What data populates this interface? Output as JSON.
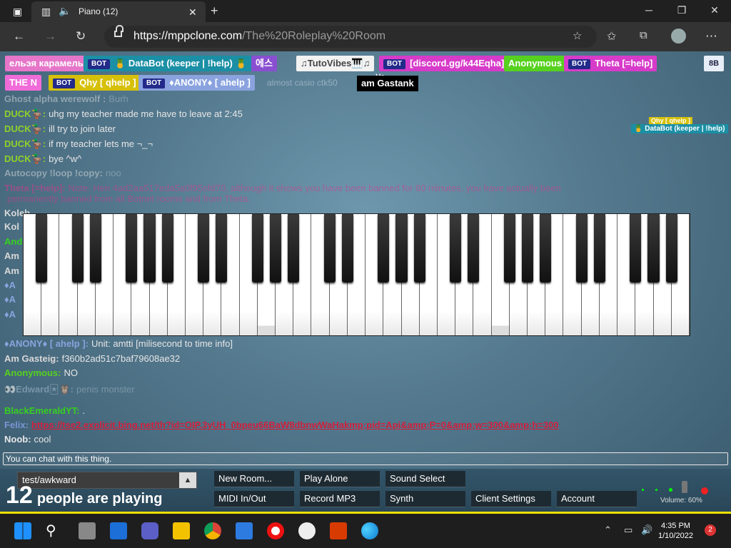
{
  "browser": {
    "tab_title": "Piano (12)",
    "url_domain": "https://mppclone.com",
    "url_path": "/The%20Roleplay%20Room"
  },
  "players": [
    {
      "name": "ельэя карамелья",
      "bg": "#e676c9",
      "bot": false
    },
    {
      "name": "🍍 DataBot (keeper | !help) 🍍",
      "bg": "#1b8fa5",
      "bot": true
    },
    {
      "name": "에스",
      "bg": "#8a4fd1",
      "bot": false
    },
    {
      "name": "♫TutoVibes🎹♫",
      "bg": "#f2f2f2",
      "bot": false
    },
    {
      "name": "[discord.gg/k44Eqha]",
      "bg": "#d73bc9",
      "bot": true
    },
    {
      "name": "Anonymous",
      "bg": "#56d11f",
      "bot": false
    },
    {
      "name": "Theta [=help]",
      "bg": "#d73bc9",
      "bot": true
    },
    {
      "name": "THE N",
      "bg": "#f06cd9",
      "bot": false
    },
    {
      "name": "Qhy [ qhelp ]",
      "bg": "#d6c00a",
      "bot": true
    },
    {
      "name": "♦ANONY♦ [ ahelp ]",
      "bg": "#8aa3df",
      "bot": true
    },
    {
      "name": "almost casio ctk50",
      "bg": "transparent",
      "bot": false
    }
  ],
  "badge_bb": "8B",
  "gastank": {
    "label": "am Gastank",
    "me": "Me"
  },
  "cursor_names": {
    "qhy": "Qhy [ qhelp ]",
    "databot": "🍍 DataBot (keeper | !help)"
  },
  "chat": [
    {
      "name": "Ghost alpha werewolf :",
      "text": "Burh",
      "color": "#c2c9cf"
    },
    {
      "name": "DUCK🦆:",
      "text": "uhg my teacher made me have to leave at 2:45",
      "color": "#8fd12a"
    },
    {
      "name": "DUCK🦆:",
      "text": "ill try to join later",
      "color": "#8fd12a"
    },
    {
      "name": "DUCK🦆:",
      "text": "if my teacher lets me ¬_¬",
      "color": "#8fd12a"
    },
    {
      "name": "DUCK🦆:",
      "text": "bye ^w^",
      "color": "#8fd12a"
    },
    {
      "name": "Autocopy !loop !copy:",
      "text": "noo",
      "color": "#c2c9cf"
    },
    {
      "name": "Theta [=help]:",
      "text": "Note: Hen 4ad2aa517eda5a0f95sfd70, although it shows you have been banned for 60 minutes, you have actually been",
      "color": "#d23c8f"
    },
    {
      "name": "",
      "text": "permanently banned from all Botnet rooms and from Theta.",
      "color": "#d23c8f"
    },
    {
      "name": "♦ANONY♦ [ ahelp ]:",
      "text": "Unit: amtti [milisecond to time info]",
      "color": "#8aa3df"
    },
    {
      "name": "Am Gasteig:",
      "text": "f360b2ad51c7baf79608ae32",
      "color": "#d8d8d8"
    },
    {
      "name": "Anonymous:",
      "text": "NO",
      "color": "#56d11f"
    },
    {
      "name": "👀Edward🃏🦉:",
      "text": "penis monster",
      "color": "#9ab3c6"
    },
    {
      "name": "BlackEmeraldYT:",
      "text": ".",
      "color": "#36d11f"
    },
    {
      "name": "Felix:",
      "text": "https://tse2.explicit.bing.net/th?id=OIP.3yUH_0bpeu66BaW8dbnwWaHakmp;pid=Api&amp;P=0&amp;w=300&amp;h=300",
      "color": "#7a95d6"
    },
    {
      "name": "Noob:",
      "text": "cool",
      "color": "#e8e8e8"
    }
  ],
  "chat_partial_names": [
    "Koleb",
    "Kol",
    "And",
    "Am",
    "Am",
    "♦A",
    "♦A",
    "♦A"
  ],
  "chat_input_placeholder": "You can chat with this thing.",
  "room_select": "test/awkward",
  "player_count": "12",
  "player_count_label": "people are playing",
  "buttons": {
    "new_room": "New Room...",
    "play_alone": "Play Alone",
    "sound_select": "Sound Select",
    "midi": "MIDI In/Out",
    "record": "Record MP3",
    "synth": "Synth",
    "client_settings": "Client Settings",
    "account": "Account"
  },
  "volume_label": "Volume: 60%",
  "taskbar": {
    "time": "4:35 PM",
    "date": "1/10/2022",
    "notifications": "2"
  },
  "piano": {
    "pressed_white_keys": [
      13,
      26
    ],
    "white_key_count": 37
  }
}
